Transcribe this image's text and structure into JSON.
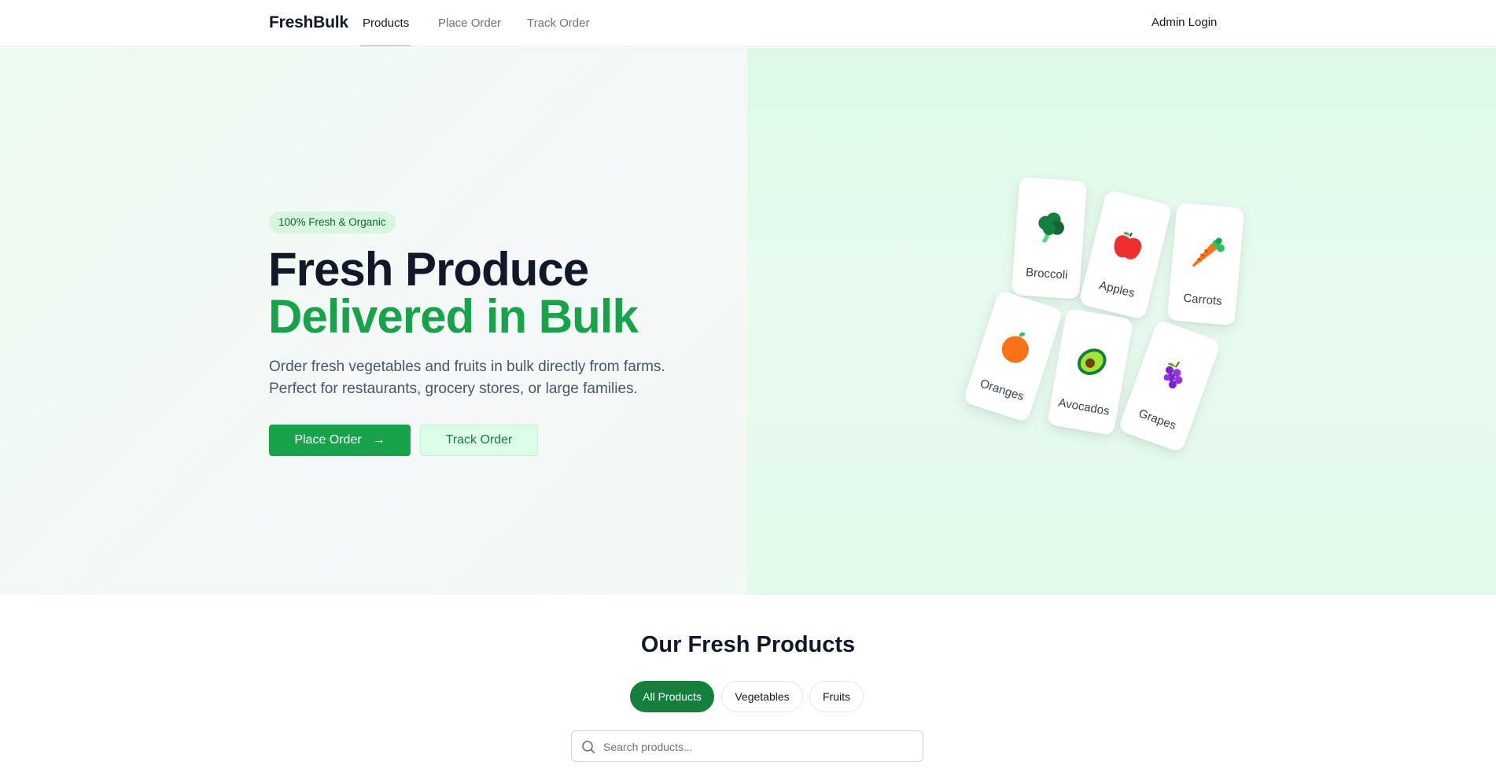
{
  "nav": {
    "brand": "FreshBulk",
    "links": [
      "Products",
      "Place Order",
      "Track Order"
    ],
    "active_link": "Products",
    "admin_label": "Admin Login"
  },
  "hero": {
    "badge": "100% Fresh & Organic",
    "headline_line1": "Fresh Produce",
    "headline_line2": "Delivered in Bulk",
    "subtext_line1": "Order fresh vegetables and fruits in bulk directly from farms.",
    "subtext_line2": "Perfect for restaurants, grocery stores, or large families.",
    "primary_button": "Place Order",
    "secondary_button": "Track Order"
  },
  "products_showcase": [
    {
      "name": "Broccoli",
      "icon": "broccoli-icon"
    },
    {
      "name": "Apples",
      "icon": "apple-icon"
    },
    {
      "name": "Carrots",
      "icon": "carrot-icon"
    },
    {
      "name": "Oranges",
      "icon": "orange-icon"
    },
    {
      "name": "Avocados",
      "icon": "avocado-icon"
    },
    {
      "name": "Grapes",
      "icon": "grapes-icon"
    }
  ],
  "products_section": {
    "title": "Our Fresh Products",
    "filters": [
      "All Products",
      "Vegetables",
      "Fruits"
    ],
    "active_filter": "All Products",
    "search_placeholder": "Search products..."
  },
  "colors": {
    "brand_green": "#16a34a",
    "dark_green": "#15803d",
    "text_dark": "#111827"
  }
}
